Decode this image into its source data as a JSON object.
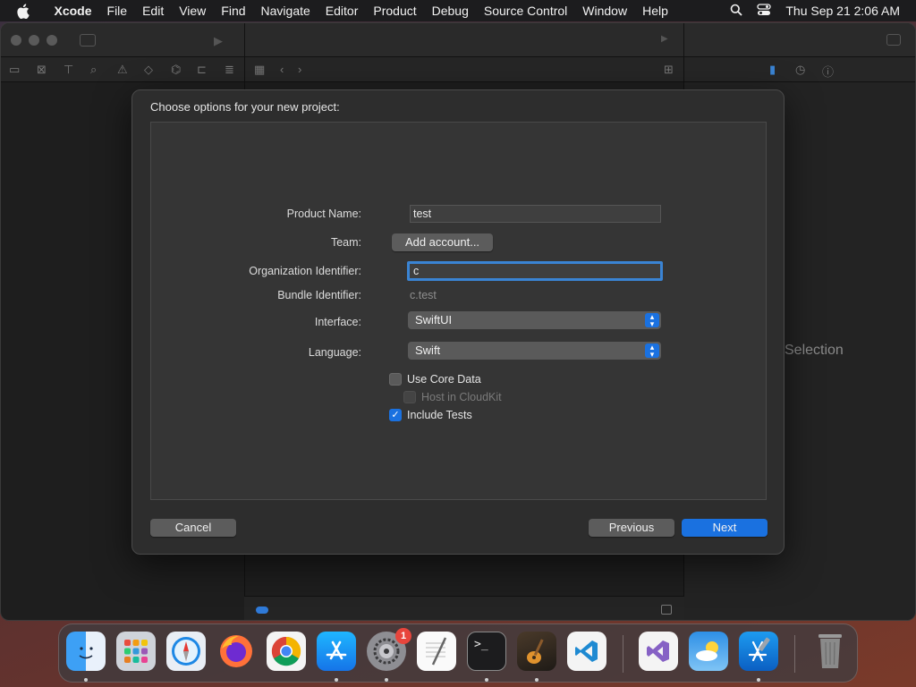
{
  "menubar": {
    "app": "Xcode",
    "items": [
      "File",
      "Edit",
      "View",
      "Find",
      "Navigate",
      "Editor",
      "Product",
      "Debug",
      "Source Control",
      "Window",
      "Help"
    ],
    "clock": "Thu Sep 21  2:06 AM"
  },
  "window": {
    "right_pane_placeholder": "Selection"
  },
  "sheet": {
    "title": "Choose options for your new project:",
    "product_name": {
      "label": "Product Name:",
      "value": "test"
    },
    "team": {
      "label": "Team:",
      "button": "Add account..."
    },
    "org_identifier": {
      "label": "Organization Identifier:",
      "value": "c"
    },
    "bundle_identifier": {
      "label": "Bundle Identifier:",
      "value": "c.test"
    },
    "interface": {
      "label": "Interface:",
      "value": "SwiftUI"
    },
    "language": {
      "label": "Language:",
      "value": "Swift"
    },
    "use_core_data": {
      "label": "Use Core Data",
      "checked": false
    },
    "host_in_cloudkit": {
      "label": "Host in CloudKit",
      "checked": false,
      "enabled": false
    },
    "include_tests": {
      "label": "Include Tests",
      "checked": true
    },
    "cancel": "Cancel",
    "previous": "Previous",
    "next": "Next"
  },
  "dock": {
    "apps": [
      "Finder",
      "Launchpad",
      "Safari",
      "Firefox",
      "Chrome",
      "App Store",
      "System Settings",
      "TextEdit",
      "Terminal",
      "GarageBand",
      "Visual Studio Code",
      "Visual Studio",
      "Weather",
      "Xcode",
      "Trash"
    ],
    "settings_badge": "1"
  },
  "colors": {
    "accent": "#1a71e0",
    "sheet_bg": "#2d2d2d",
    "panel_bg": "#353535"
  }
}
